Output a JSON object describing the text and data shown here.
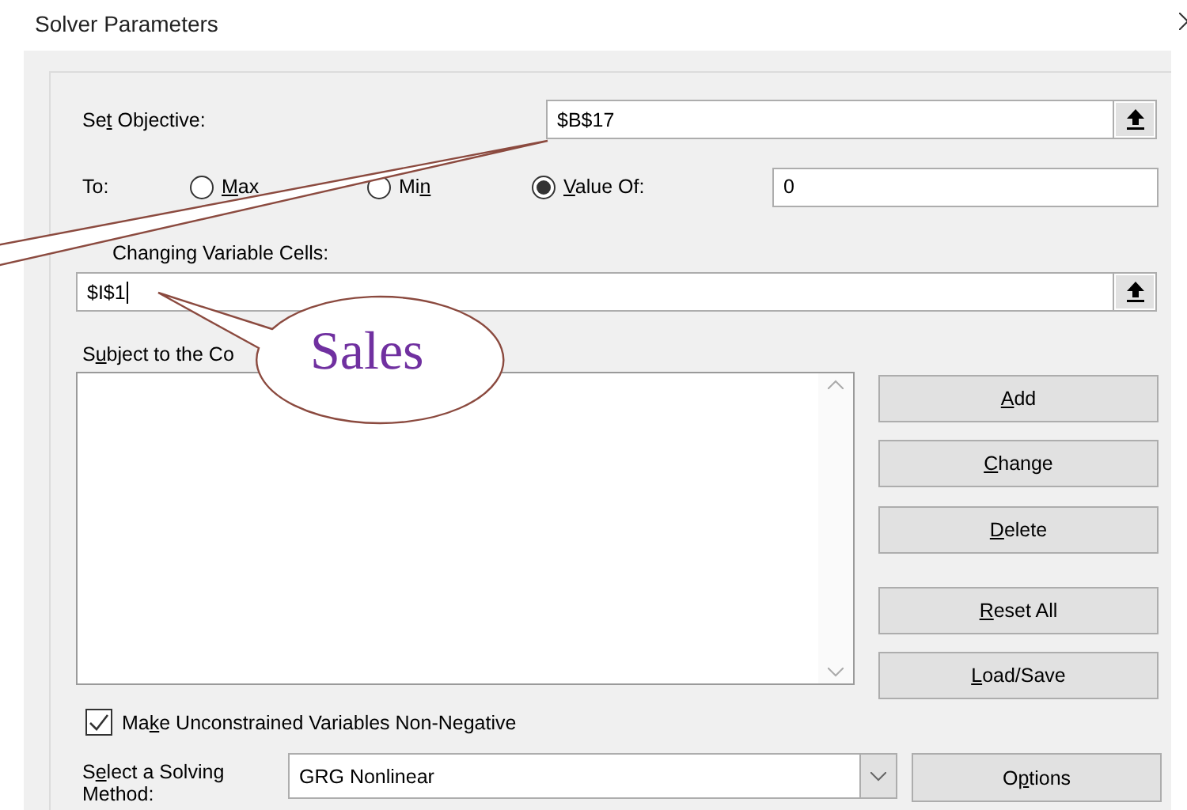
{
  "window": {
    "title": "Solver Parameters"
  },
  "objective": {
    "label": {
      "pre": "Se",
      "key": "t",
      "post": " Objective:"
    },
    "value": "$B$17"
  },
  "to": {
    "label": "To:",
    "options": [
      {
        "label": {
          "key": "M",
          "post": "ax"
        },
        "selected": false
      },
      {
        "label": {
          "pre": "Mi",
          "key": "n"
        },
        "selected": false
      },
      {
        "label": {
          "key": "V",
          "post": "alue Of:"
        },
        "selected": true
      }
    ],
    "value": "0"
  },
  "changing": {
    "label": "Changing Variable Cells:",
    "value": "$I$1"
  },
  "constraints": {
    "label": {
      "pre": "S",
      "key": "u",
      "post": "bject to the Co"
    }
  },
  "buttons": [
    {
      "label": {
        "key": "A",
        "post": "dd"
      }
    },
    {
      "label": {
        "key": "C",
        "post": "hange"
      }
    },
    {
      "label": {
        "key": "D",
        "post": "elete"
      }
    },
    {
      "label": {
        "key": "R",
        "post": "eset All"
      }
    },
    {
      "label": {
        "key": "L",
        "post": "oad/Save"
      }
    }
  ],
  "non_negative": {
    "label": {
      "pre": "Ma",
      "key": "k",
      "post": "e Unconstrained Variables Non-Negative"
    },
    "checked": true
  },
  "method": {
    "label": {
      "pre": "S",
      "key": "e",
      "post": "lect a Solving Method:"
    },
    "value": "GRG Nonlinear"
  },
  "options_button": {
    "label": {
      "pre": "O",
      "key": "p",
      "post": "tions"
    }
  },
  "callout": {
    "text": "Sales"
  }
}
